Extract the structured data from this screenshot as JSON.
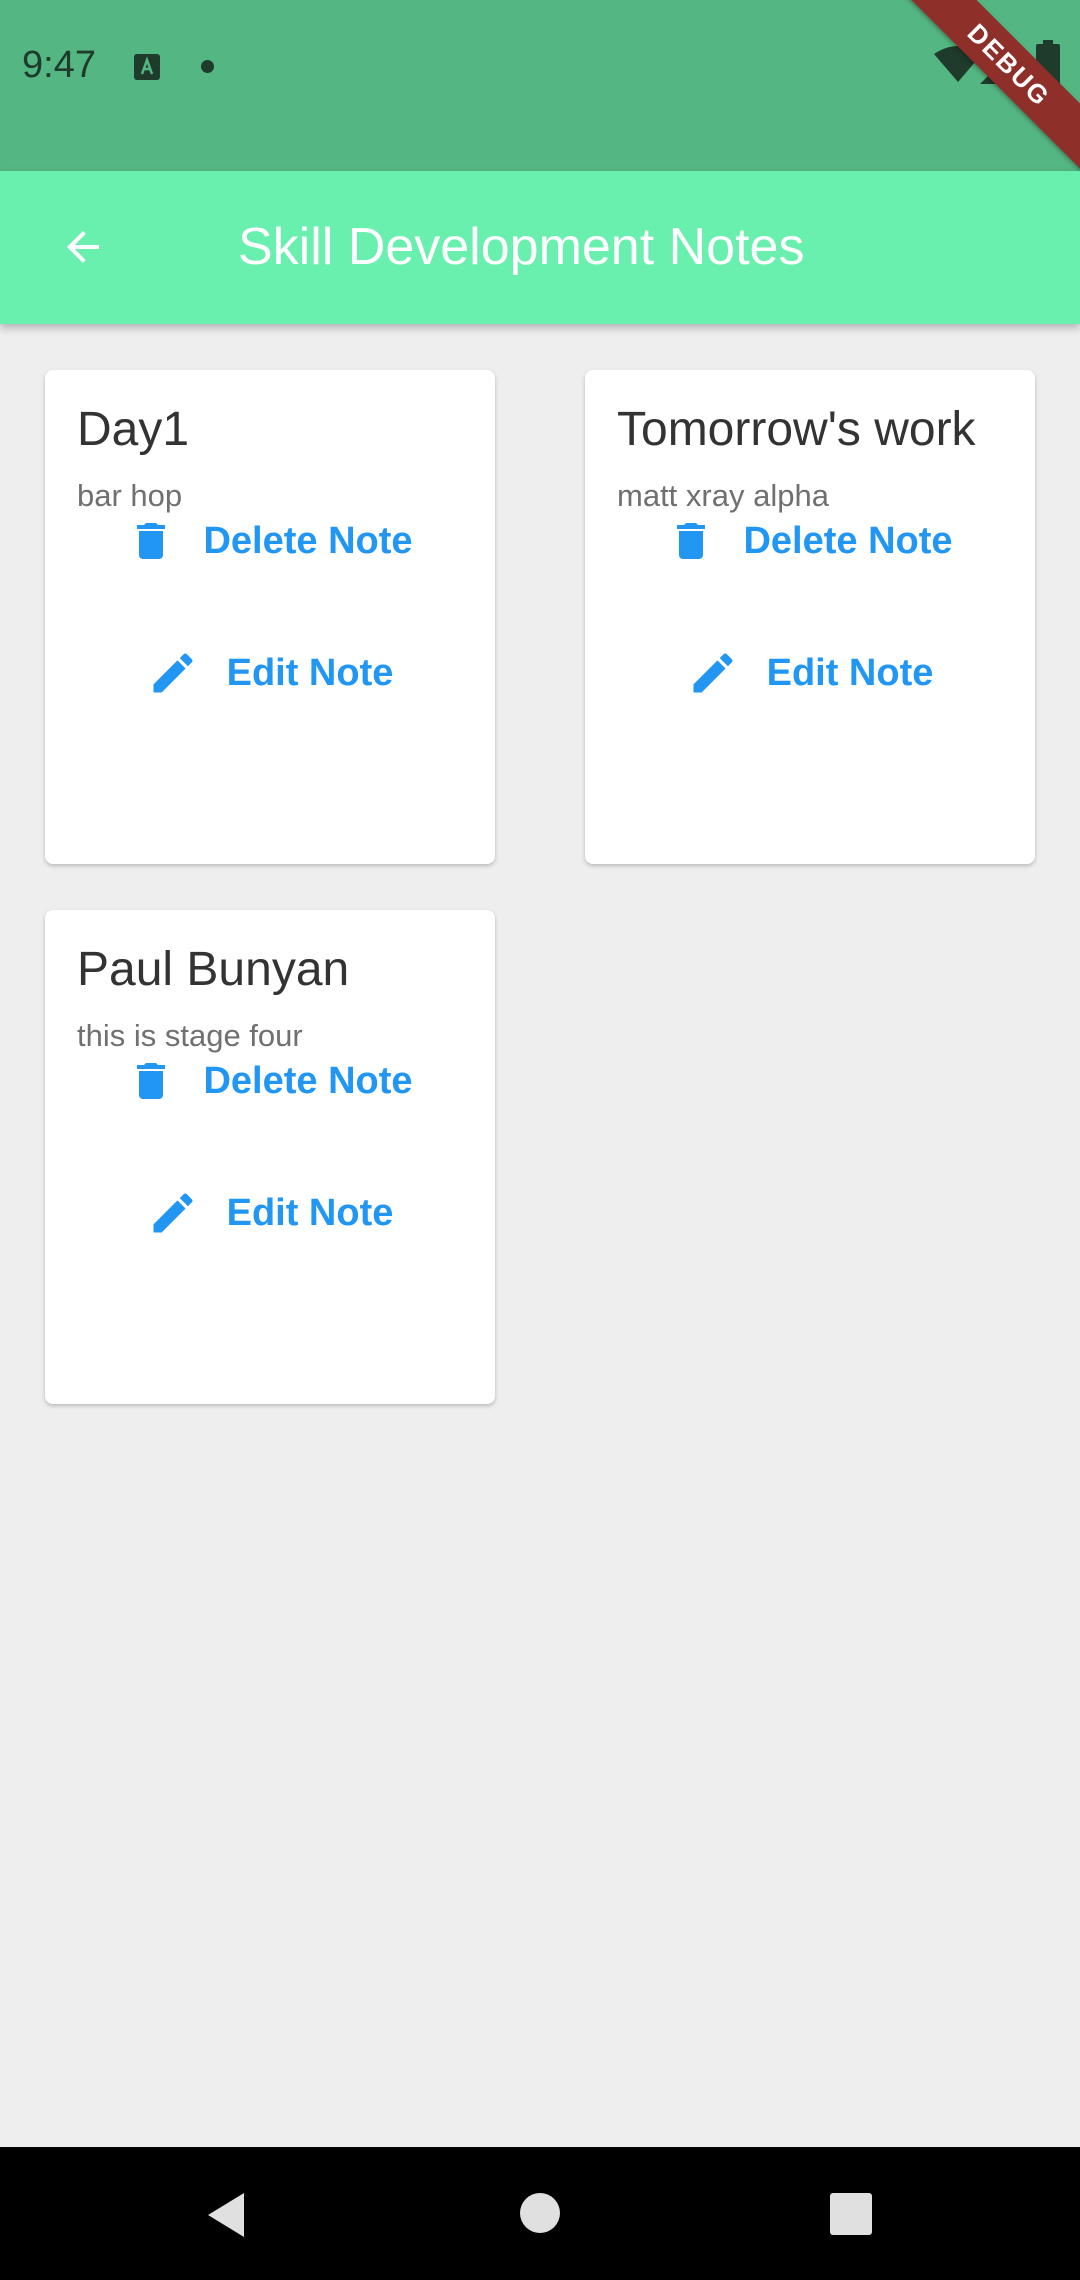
{
  "status_bar": {
    "time": "9:47",
    "icons": [
      "a-icon",
      "notification-dot",
      "wifi-icon",
      "signal-icon",
      "battery-icon"
    ]
  },
  "debug_banner": {
    "label": "DEBUG",
    "color": "#8e2f2a"
  },
  "app_bar": {
    "title": "Skill Development Notes",
    "back_icon": "arrow-back-icon",
    "background": "#69f0ae"
  },
  "notes": [
    {
      "title": "Day1",
      "subtitle": "bar hop",
      "delete_label": "Delete Note",
      "edit_label": "Edit Note"
    },
    {
      "title": "Tomorrow's work",
      "subtitle": "matt xray alpha",
      "delete_label": "Delete Note",
      "edit_label": "Edit Note"
    },
    {
      "title": "Paul Bunyan",
      "subtitle": "this is stage four",
      "delete_label": "Delete Note",
      "edit_label": "Edit Note"
    }
  ],
  "colors": {
    "accent": "#2196f3",
    "status_bar": "#54b682",
    "background": "#eeeeee"
  },
  "nav_bar": {
    "icons": [
      "nav-back-icon",
      "nav-home-icon",
      "nav-recents-icon"
    ]
  }
}
